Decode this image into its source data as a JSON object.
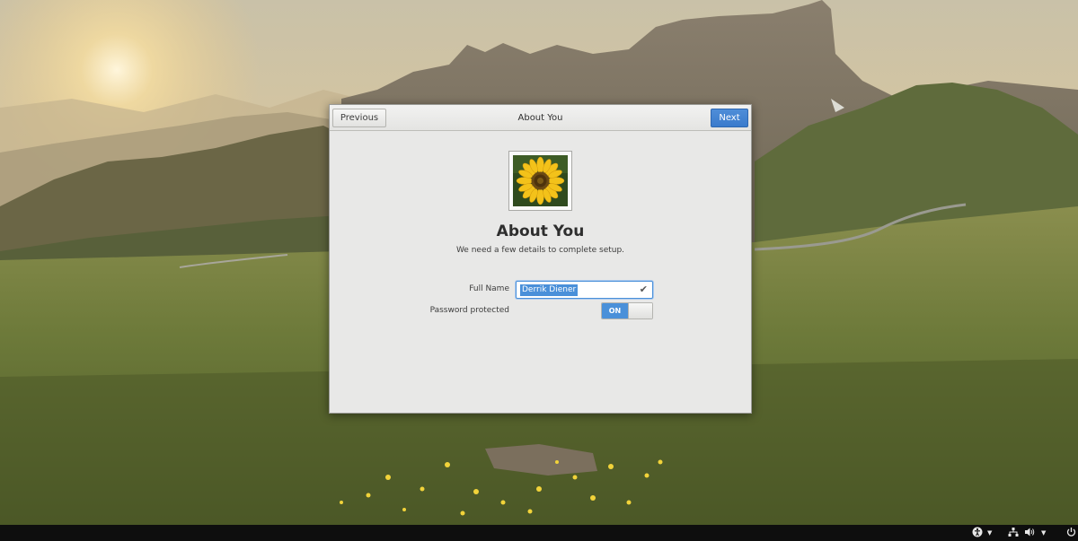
{
  "dialog": {
    "title": "About You",
    "previous_label": "Previous",
    "next_label": "Next",
    "heading": "About You",
    "subtitle": "We need a few details to complete setup.",
    "full_name_label": "Full Name",
    "full_name_value": "Derrik Diener",
    "password_label": "Password protected",
    "password_toggle": "ON"
  },
  "icons": {
    "valid": "checkmark-icon",
    "accessibility": "accessibility-icon",
    "network": "network-icon",
    "volume": "volume-icon",
    "power": "power-icon",
    "dropdown": "chevron-down-icon"
  },
  "colors": {
    "accent": "#4a90d9",
    "dialog_bg": "#e8e8e7",
    "panel_bg": "#0e0e0e"
  }
}
